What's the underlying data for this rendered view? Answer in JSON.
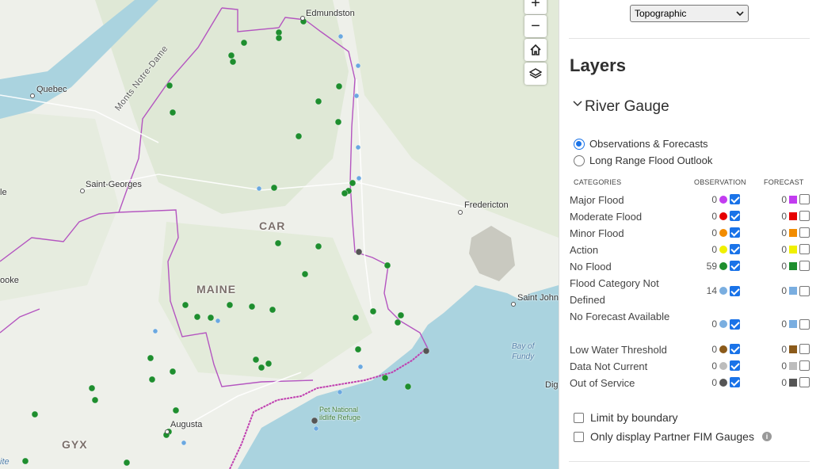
{
  "map": {
    "place_labels": [
      "Edmundston",
      "Quebec",
      "Saint-Georges",
      "Fredericton",
      "Saint John",
      "ooke",
      "le",
      "Augusta",
      "ite",
      "Dig"
    ],
    "region_labels": [
      "CAR",
      "MAINE",
      "GYX"
    ],
    "water_label": "Bay of Fundy",
    "water_line1": "Bay of",
    "water_line2": "Fundy",
    "range_label": "Monts Notre-Dame",
    "refuge_line1": "Pet   National",
    "refuge_line2": "ildlife Refuge",
    "controls": {
      "zoom_in": "+",
      "zoom_out": "−"
    },
    "colors": {
      "water": "#aad3df",
      "boundary": "#b455c0",
      "gauge_green": "#1e8e2e",
      "gauge_blue": "#6aa8e0",
      "gauge_gray": "#555555"
    }
  },
  "panel": {
    "basemap": {
      "selected": "Topographic"
    },
    "layers_title": "Layers",
    "section_title": "River Gauge",
    "radios": [
      {
        "label": "Observations & Forecasts",
        "checked": true
      },
      {
        "label": "Long Range Flood Outlook",
        "checked": false
      }
    ],
    "column_headers": {
      "categories": "CATEGORIES",
      "observation": "OBSERVATION",
      "forecast": "FORECAST"
    },
    "categories": [
      {
        "name": "Major Flood",
        "obs_count": "0",
        "fc_count": "0",
        "color": "#c23cf0"
      },
      {
        "name": "Moderate Flood",
        "obs_count": "0",
        "fc_count": "0",
        "color": "#e60000"
      },
      {
        "name": "Minor Flood",
        "obs_count": "0",
        "fc_count": "0",
        "color": "#f28c00"
      },
      {
        "name": "Action",
        "obs_count": "0",
        "fc_count": "0",
        "color": "#f0f000"
      },
      {
        "name": "No Flood",
        "obs_count": "59",
        "fc_count": "0",
        "color": "#1e8e2e"
      },
      {
        "name": "Flood Category Not Defined",
        "obs_count": "14",
        "fc_count": "0",
        "color": "#7aaee0"
      },
      {
        "name": "No Forecast Available",
        "obs_count": "0",
        "fc_count": "0",
        "color": "#7aaee0"
      },
      {
        "name": "Low Water Threshold",
        "obs_count": "0",
        "fc_count": "0",
        "color": "#8b5a1a"
      },
      {
        "name": "Data Not Current",
        "obs_count": "0",
        "fc_count": "0",
        "color": "#bdbdbd"
      },
      {
        "name": "Out of Service",
        "obs_count": "0",
        "fc_count": "0",
        "color": "#555555"
      }
    ],
    "options": [
      {
        "label": "Limit by boundary",
        "checked": false
      },
      {
        "label": "Only display Partner FIM Gauges",
        "checked": false
      }
    ]
  }
}
